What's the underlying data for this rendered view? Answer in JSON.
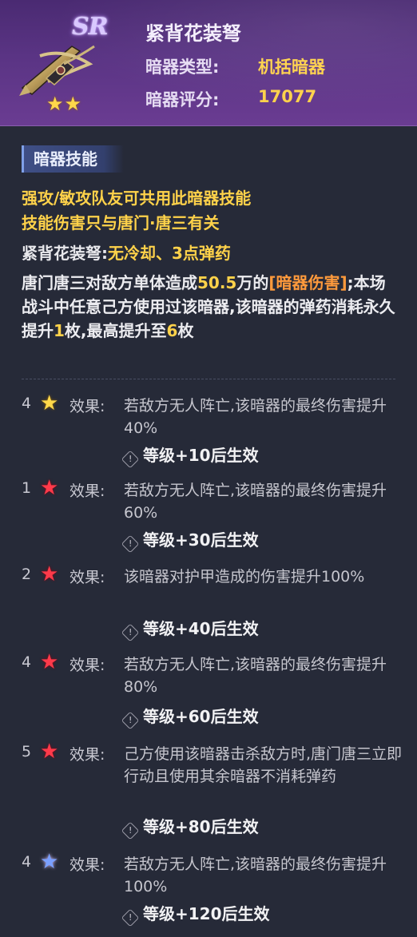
{
  "header": {
    "rarity": "SR",
    "stars": [
      "★",
      "★"
    ],
    "title": "紧背花装弩",
    "type_label": "暗器类型:",
    "type_value": "机括暗器",
    "score_label": "暗器评分:",
    "score_value": "17077"
  },
  "skill": {
    "tag": "暗器技能",
    "gold_line1": "强攻/敏攻队友可共用此暗器技能",
    "gold_line2": "技能伤害只与唐门·唐三有关",
    "cooldown_prefix": "紧背花装弩:",
    "cooldown_value": "无冷却、3点弹药",
    "body_1": "唐门唐三对敌方单体造成",
    "body_dmg": "50.5",
    "body_2": "万的",
    "body_tag": "[暗器伤害]",
    "body_3": ";本场战斗中任意己方使用过该暗器,该暗器的弹药消耗永久提升",
    "body_inc": "1",
    "body_4": "枚,最高提升至",
    "body_max": "6",
    "body_5": "枚"
  },
  "effects": [
    {
      "num": "4",
      "star": "★",
      "star_color": "gold",
      "label": "效果:",
      "text": "若敌方无人阵亡,该暗器的最终伤害提升40%",
      "req_icon": "!",
      "req": "等级+10后生效"
    },
    {
      "num": "1",
      "star": "★",
      "star_color": "red",
      "label": "效果:",
      "text": "若敌方无人阵亡,该暗器的最终伤害提升60%",
      "req_icon": "!",
      "req": "等级+30后生效"
    },
    {
      "num": "2",
      "star": "★",
      "star_color": "red",
      "label": "效果:",
      "text": "该暗器对护甲造成的伤害提升100%",
      "req_icon": "!",
      "req": "等级+40后生效"
    },
    {
      "num": "4",
      "star": "★",
      "star_color": "red",
      "label": "效果:",
      "text": "若敌方无人阵亡,该暗器的最终伤害提升80%",
      "req_icon": "!",
      "req": "等级+60后生效"
    },
    {
      "num": "5",
      "star": "★",
      "star_color": "red",
      "label": "效果:",
      "text": "己方使用该暗器击杀敌方时,唐门唐三立即行动且使用其余暗器不消耗弹药",
      "req_icon": "!",
      "req": "等级+80后生效"
    },
    {
      "num": "4",
      "star": "★",
      "star_color": "blue",
      "label": "效果:",
      "text": "若敌方无人阵亡,该暗器的最终伤害提升100%",
      "req_icon": "!",
      "req": "等级+120后生效"
    }
  ]
}
